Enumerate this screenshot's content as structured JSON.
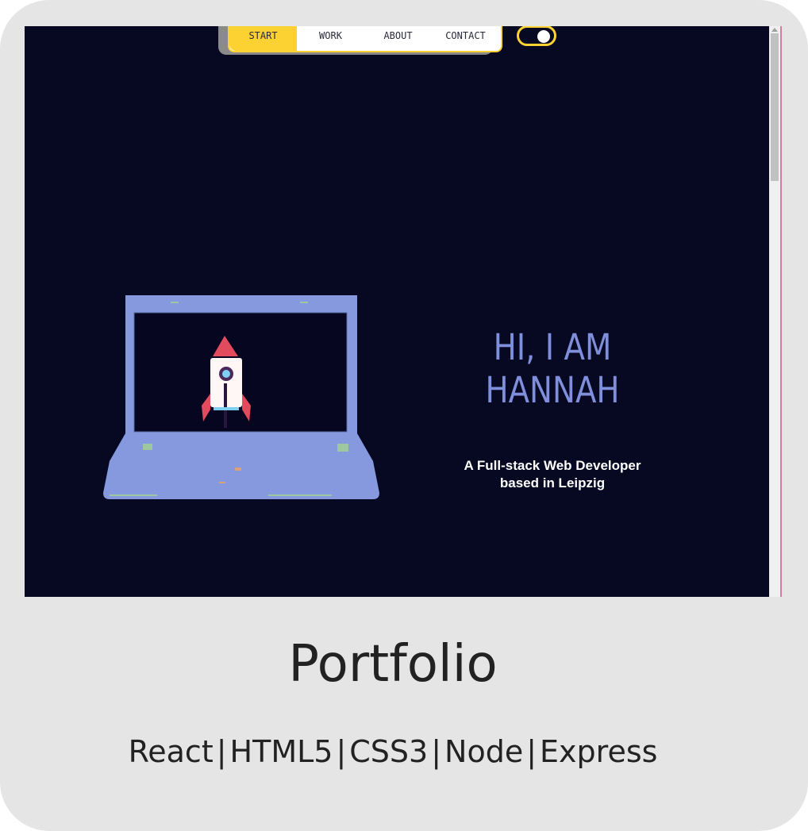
{
  "nav": {
    "items": [
      {
        "label": "START",
        "active": true
      },
      {
        "label": "WORK",
        "active": false
      },
      {
        "label": "ABOUT",
        "active": false
      },
      {
        "label": "CONTACT",
        "active": false
      }
    ]
  },
  "theme_toggle": {
    "icon": "toggle-icon"
  },
  "hero": {
    "title_line1": "HI, I AM",
    "title_line2": "HANNAH",
    "subtitle_line1": "A Full-stack Web Developer",
    "subtitle_line2": "based in Leipzig"
  },
  "card": {
    "title": "Portfolio",
    "tags": [
      "React",
      "HTML5",
      "CSS3",
      "Node",
      "Express"
    ],
    "separator": "|"
  },
  "colors": {
    "background": "#070822",
    "accent": "#fcd232",
    "hero_text": "#7f8fdb",
    "card_bg": "#e5e5e5"
  }
}
